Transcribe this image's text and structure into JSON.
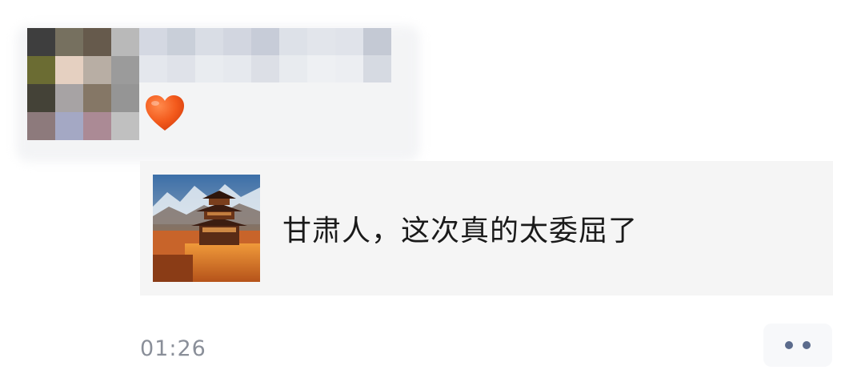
{
  "post": {
    "avatar_colors": [
      "#3e3e3e",
      "#76705f",
      "#665a4c",
      "#b9b9b9",
      "#6b6c33",
      "#e5d0c1",
      "#b8aea4",
      "#9b9b9b",
      "#444237",
      "#a7a3a4",
      "#857766",
      "#959595",
      "#8d7a7c",
      "#a4a8c4",
      "#ab8a95",
      "#c0c0c0"
    ],
    "name_colors": [
      "#d4d8e2",
      "#c9cfd9",
      "#d9dde5",
      "#d2d6e0",
      "#c7ccd8",
      "#dde1e8",
      "#e2e5eb",
      "#e0e3ea",
      "#c4c9d4",
      "#e4e7ed",
      "#dfe2e9",
      "#e9ecf0",
      "#e6e9ee",
      "#dcdfe6",
      "#e8ebef",
      "#eef0f3",
      "#eceef2",
      "#d6dae2"
    ],
    "heart_icon": "heart-emoji",
    "heart_color": "#f35a1c",
    "shared_article": {
      "thumbnail_icon": "pavilion-fortress-image",
      "title": "甘肃人，这次真的太委屈了"
    },
    "timestamp": "01:26",
    "more_icon": "two-dots-more-icon"
  }
}
